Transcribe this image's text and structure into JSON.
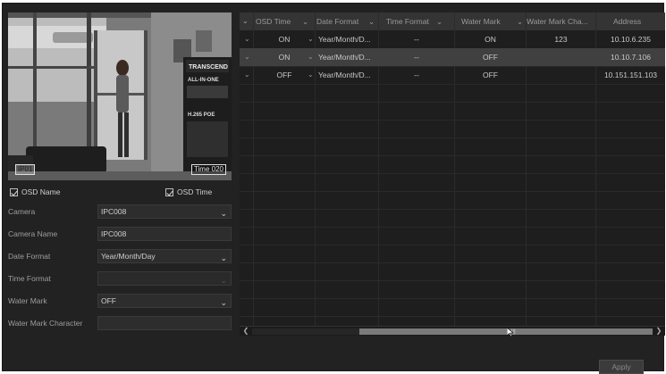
{
  "preview": {
    "osd_name_text": "IP01",
    "osd_time_text": "Time 020",
    "sign_lines": [
      "TRANSCEND",
      "ALL-IN-ONE",
      "H.265 POE"
    ]
  },
  "checkboxes": {
    "osd_name_label": "OSD Name",
    "osd_time_label": "OSD Time"
  },
  "form": {
    "camera_label": "Camera",
    "camera_value": "IPC008",
    "camera_name_label": "Camera Name",
    "camera_name_value": "IPC008",
    "date_format_label": "Date Format",
    "date_format_value": "Year/Month/Day",
    "time_format_label": "Time Format",
    "time_format_value": "",
    "water_mark_label": "Water Mark",
    "water_mark_value": "OFF",
    "water_mark_char_label": "Water Mark Character",
    "water_mark_char_value": ""
  },
  "table": {
    "headers": [
      "OSD Time",
      "Date Format",
      "Time Format",
      "Water Mark",
      "Water Mark Cha...",
      "Address"
    ],
    "rows": [
      {
        "osd_time": "ON",
        "date_format": "Year/Month/D...",
        "time_format": "--",
        "water_mark": "ON",
        "wm_char": "123",
        "address": "10.10.6.235",
        "selected": false
      },
      {
        "osd_time": "ON",
        "date_format": "Year/Month/D...",
        "time_format": "--",
        "water_mark": "OFF",
        "wm_char": "",
        "address": "10.10.7.106",
        "selected": true
      },
      {
        "osd_time": "OFF",
        "date_format": "Year/Month/D...",
        "time_format": "--",
        "water_mark": "OFF",
        "wm_char": "",
        "address": "10.151.151.103",
        "selected": false
      }
    ]
  },
  "apply_label": "Apply",
  "colors": {
    "background": "#222222",
    "header": "#343434",
    "selected_row": "#404040"
  }
}
